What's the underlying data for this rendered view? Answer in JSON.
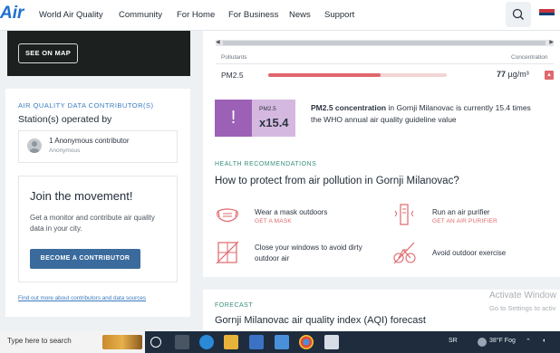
{
  "nav": {
    "logo": "Air",
    "links": [
      "World Air Quality",
      "Community",
      "For Home",
      "For Business",
      "News",
      "Support"
    ]
  },
  "map": {
    "button": "SEE ON MAP"
  },
  "contributors": {
    "section_label": "AIR QUALITY DATA CONTRIBUTOR(S)",
    "station_title": "Station(s) operated by",
    "contributor_name": "1 Anonymous contributor",
    "contributor_sub": "Anonymous"
  },
  "join": {
    "title": "Join the movement!",
    "text": "Get a monitor and contribute air quality data in your city.",
    "button": "BECOME A CONTRIBUTOR",
    "link": "Find out more about contributors and data sources"
  },
  "pollutants": {
    "col_left": "Pollutants",
    "col_right": "Concentration",
    "rows": [
      {
        "name": "PM2.5",
        "value": "77",
        "unit": "µg/m³",
        "fill_fraction": 0.63
      }
    ]
  },
  "pm_card": {
    "icon": "!",
    "small": "PM2.5",
    "big": "x15.4",
    "desc_bold": "PM2.5 concentration",
    "desc_rest": " in Gornji Milanovac is currently 15.4 times the WHO annual air quality guideline value"
  },
  "health": {
    "label": "HEALTH RECOMMENDATIONS",
    "title": "How to protect from air pollution in Gornji Milanovac?",
    "recs": [
      {
        "icon": "mask-icon",
        "title": "Wear a mask outdoors",
        "sub": "GET A MASK"
      },
      {
        "icon": "air-purifier-icon",
        "title": "Run an air purifier",
        "sub": "GET AN AIR PURIFIER"
      },
      {
        "icon": "window-closed-icon",
        "title": "Close your windows to avoid dirty outdoor air",
        "sub": ""
      },
      {
        "icon": "no-exercise-icon",
        "title": "Avoid outdoor exercise",
        "sub": ""
      }
    ]
  },
  "forecast": {
    "label": "FORECAST",
    "title": "Gornji Milanovac air quality index (AQI) forecast"
  },
  "watermark": {
    "line1": "Activate Window",
    "line2": "Go to Settings to activ"
  },
  "taskbar": {
    "search": "Type here to search",
    "sr": "SR",
    "weather": "38°F  Fog"
  },
  "colors": {
    "accent_red": "#e0676c",
    "pm_purple": "#9c61b6",
    "link_blue": "#3a7bbf",
    "button_blue": "#3a6b9c",
    "section_teal": "#3a8f7f"
  }
}
